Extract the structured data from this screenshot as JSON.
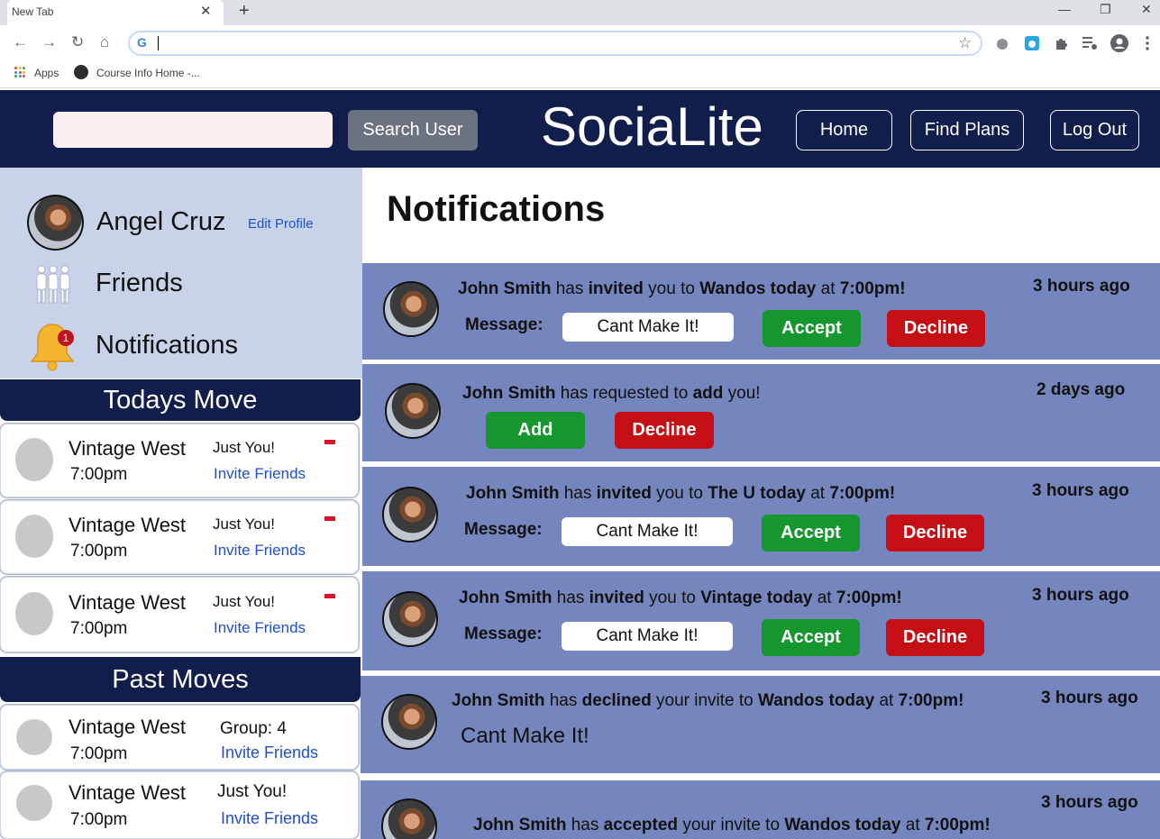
{
  "browser": {
    "tab_title": "New Tab",
    "tab_close": "✕",
    "new_tab": "+",
    "win_min": "—",
    "win_restore": "❐",
    "win_close": "✕",
    "back": "←",
    "forward": "→",
    "reload": "↻",
    "home": "⌂",
    "g_icon": "G",
    "star": "☆",
    "bookmarks": {
      "apps": "Apps",
      "course": "Course Info Home -..."
    }
  },
  "header": {
    "search_button": "Search User",
    "brand": "SociaLite",
    "nav": {
      "home": "Home",
      "find_plans": "Find Plans",
      "log_out": "Log Out"
    }
  },
  "sidebar": {
    "user_name": "Angel Cruz",
    "edit_profile": "Edit Profile",
    "friends": "Friends",
    "notifications": "Notifications",
    "notification_count": "1",
    "todays_move_title": "Todays Move",
    "todays_moves": [
      {
        "place": "Vintage West",
        "time": "7:00pm",
        "status": "Just You!",
        "invite": "Invite Friends"
      },
      {
        "place": "Vintage West",
        "time": "7:00pm",
        "status": "Just You!",
        "invite": "Invite Friends"
      },
      {
        "place": "Vintage West",
        "time": "7:00pm",
        "status": "Just You!",
        "invite": "Invite Friends"
      }
    ],
    "past_moves_title": "Past Moves",
    "past_moves": [
      {
        "place": "Vintage West",
        "time": "7:00pm",
        "status": "Group: 4",
        "invite": "Invite Friends"
      },
      {
        "place": "Vintage West",
        "time": "7:00pm",
        "status": "Just You!",
        "invite": "Invite Friends"
      }
    ]
  },
  "main": {
    "title": "Notifications",
    "notifications": [
      {
        "name": "John Smith",
        "t1": "has",
        "verb": "invited",
        "t2": "you to",
        "place": "Wandos today",
        "t3": "at",
        "time_of": "7:00pm!",
        "ago": "3 hours ago",
        "message_label": "Message:",
        "message": "Cant Make It!",
        "accept": "Accept",
        "decline": "Decline"
      },
      {
        "name": "John Smith",
        "t1": "has requested to",
        "verb": "add",
        "t2": "you!",
        "ago": "2 days ago",
        "add": "Add",
        "decline": "Decline"
      },
      {
        "name": "John Smith",
        "t1": "has",
        "verb": "invited",
        "t2": "you to",
        "place": "The U today",
        "t3": "at",
        "time_of": "7:00pm!",
        "ago": "3 hours ago",
        "message_label": "Message:",
        "message": "Cant Make It!",
        "accept": "Accept",
        "decline": "Decline"
      },
      {
        "name": "John Smith",
        "t1": "has",
        "verb": "invited",
        "t2": "you to",
        "place": "Vintage today",
        "t3": "at",
        "time_of": "7:00pm!",
        "ago": "3 hours ago",
        "message_label": "Message:",
        "message": "Cant Make It!",
        "accept": "Accept",
        "decline": "Decline"
      },
      {
        "name": "John Smith",
        "t1": "has",
        "verb": "declined",
        "t2": "your invite to",
        "place": "Wandos today",
        "t3": "at",
        "time_of": "7:00pm!",
        "ago": "3 hours ago",
        "quote": "Cant Make It!"
      },
      {
        "name": "John Smith",
        "t1": "has",
        "verb": "accepted",
        "t2": "your invite to",
        "place": "Wandos today",
        "t3": "at",
        "time_of": "7:00pm!",
        "ago": "3 hours ago"
      }
    ]
  },
  "colors": {
    "navy": "#111d4a",
    "sidebar": "#c8d3ea",
    "card_blue": "#7486bd",
    "accept_green": "#15962e",
    "decline_red": "#c60f14",
    "link_blue": "#1f4fd1"
  }
}
